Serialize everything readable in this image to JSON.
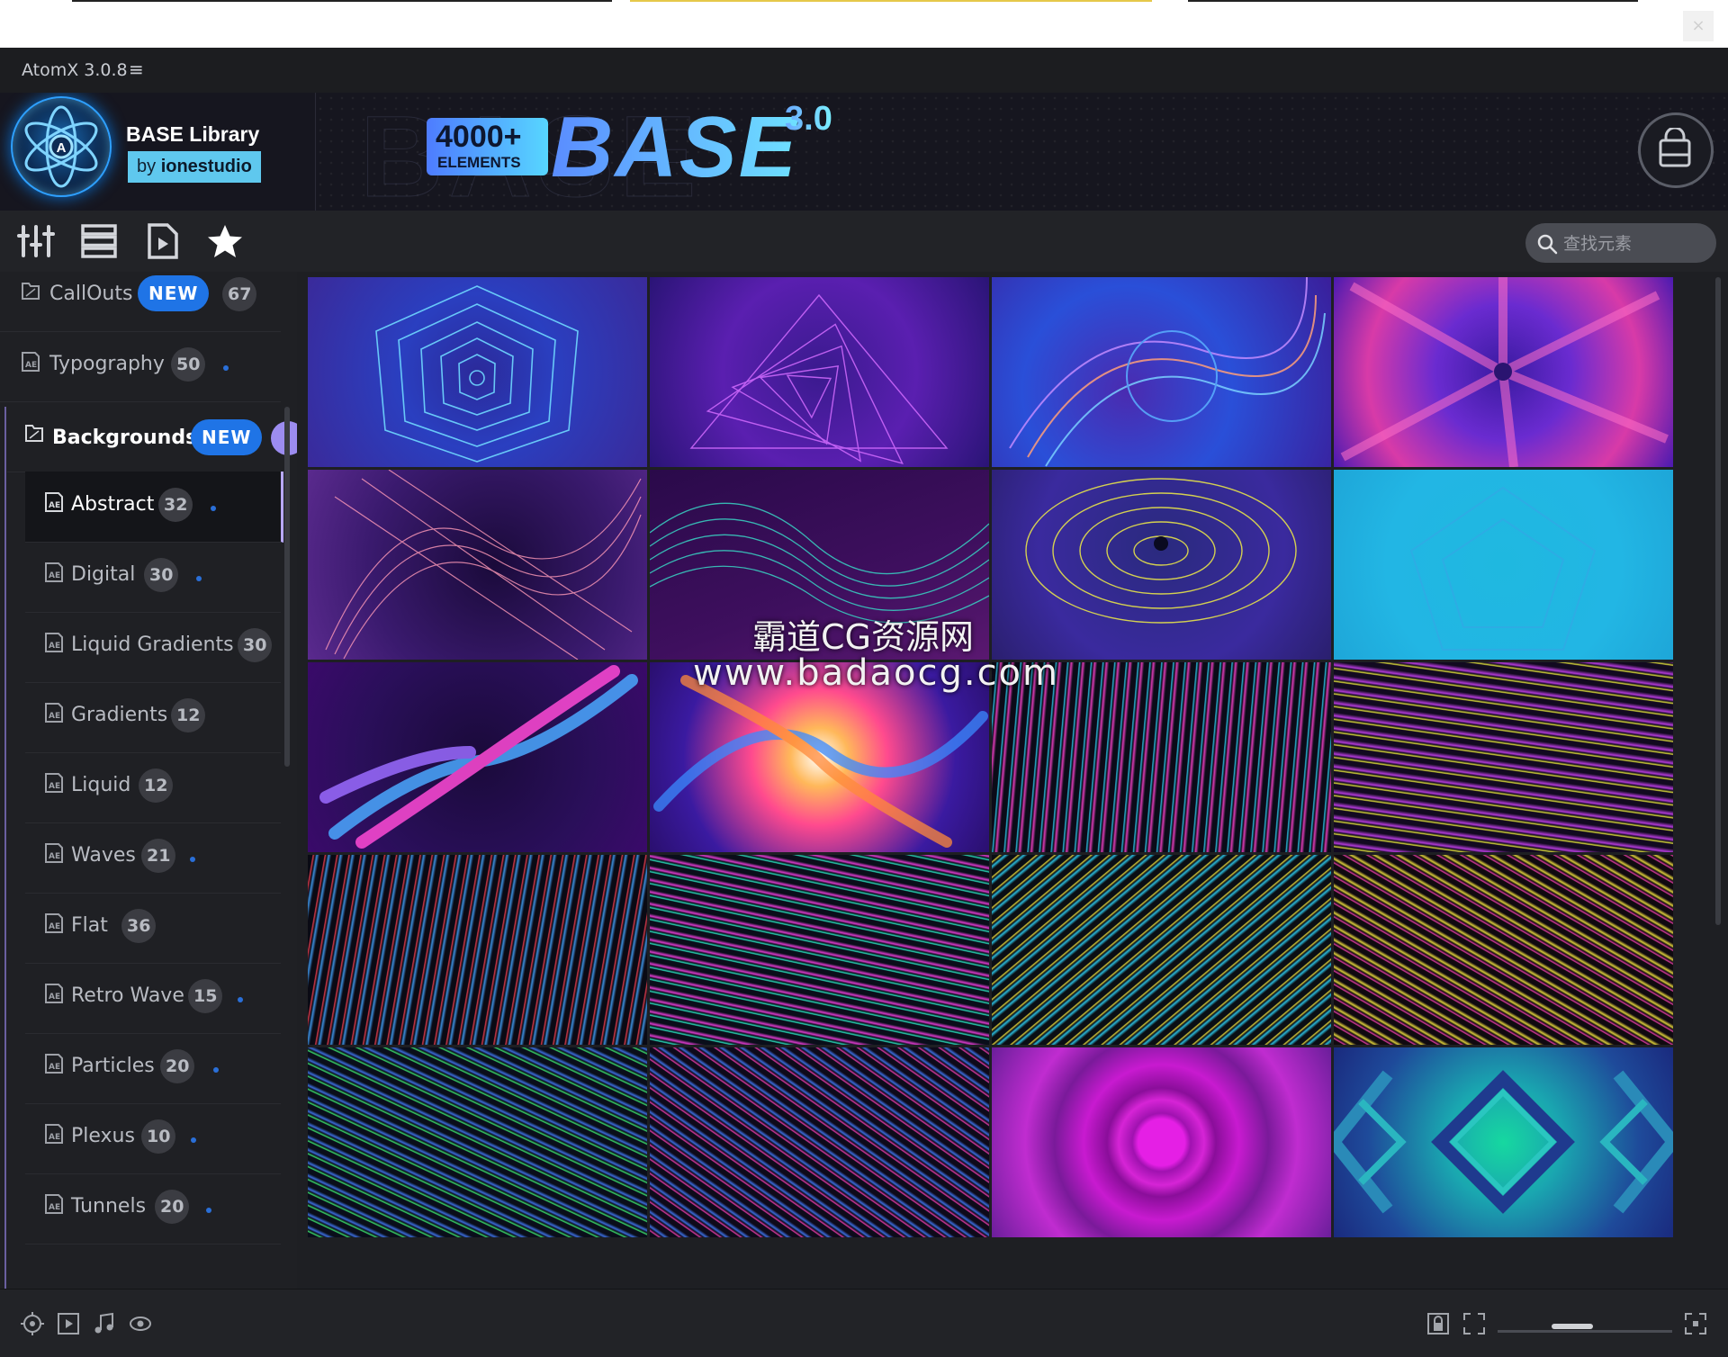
{
  "window": {
    "app_title": "AtomX 3.0.8",
    "close_glyph": "×"
  },
  "banner": {
    "library_name": "BASE Library",
    "by_prefix": "by",
    "by_author": "ionestudio",
    "elements_count": "4000+",
    "elements_label": "ELEMENTS",
    "base_word": "BASE",
    "version": "3.0"
  },
  "toolbar": {
    "icons": [
      "sliders-icon",
      "list-icon",
      "play-file-icon",
      "star-icon"
    ],
    "search_placeholder": "查找元素"
  },
  "sidebar": {
    "categories": [
      {
        "label": "CallOuts",
        "badge": "NEW",
        "count": "67"
      },
      {
        "label": "Typography",
        "count": "50"
      },
      {
        "label": "Backgrounds",
        "badge": "NEW",
        "count": ""
      }
    ],
    "subcategories": [
      {
        "label": "Abstract",
        "count": "32",
        "active": true
      },
      {
        "label": "Digital",
        "count": "30"
      },
      {
        "label": "Liquid Gradients",
        "count": "30"
      },
      {
        "label": "Gradients",
        "count": "12"
      },
      {
        "label": "Liquid",
        "count": "12"
      },
      {
        "label": "Waves",
        "count": "21"
      },
      {
        "label": "Flat",
        "count": "36"
      },
      {
        "label": "Retro Wave",
        "count": "15"
      },
      {
        "label": "Particles",
        "count": "20"
      },
      {
        "label": "Plexus",
        "count": "10"
      },
      {
        "label": "Tunnels",
        "count": "20"
      }
    ]
  },
  "grid": {
    "thumbnails": [
      "blue-hexagon-tunnel",
      "purple-triangle-spiral",
      "blue-orange-swirl",
      "pink-purple-starburst",
      "pink-wireframe-twist",
      "teal-wave-lines",
      "yellow-eye-lines",
      "cyan-pentagon-flat",
      "pink-blue-swirl",
      "orange-blue-swirl",
      "teal-pink-streaks",
      "yellow-pink-streaks",
      "red-blue-streaks",
      "teal-pink-streaks-2",
      "yellow-teal-streaks",
      "pink-yellow-streaks",
      "green-blue-streaks",
      "pink-blue-streaks",
      "magenta-rings",
      "teal-diamond-chevrons"
    ]
  },
  "watermark": {
    "line1": "霸道CG资源网",
    "line2": "www.badaocg.com"
  },
  "statusbar": {
    "icons": [
      "aim-icon",
      "video-icon",
      "music-icon",
      "eye-icon",
      "lock-icon",
      "expand-icon",
      "fullscreen-icon"
    ]
  },
  "colors": {
    "accent_blue": "#1f74e6",
    "highlight_purple": "#b9a9ff",
    "panel": "#1f2024"
  }
}
